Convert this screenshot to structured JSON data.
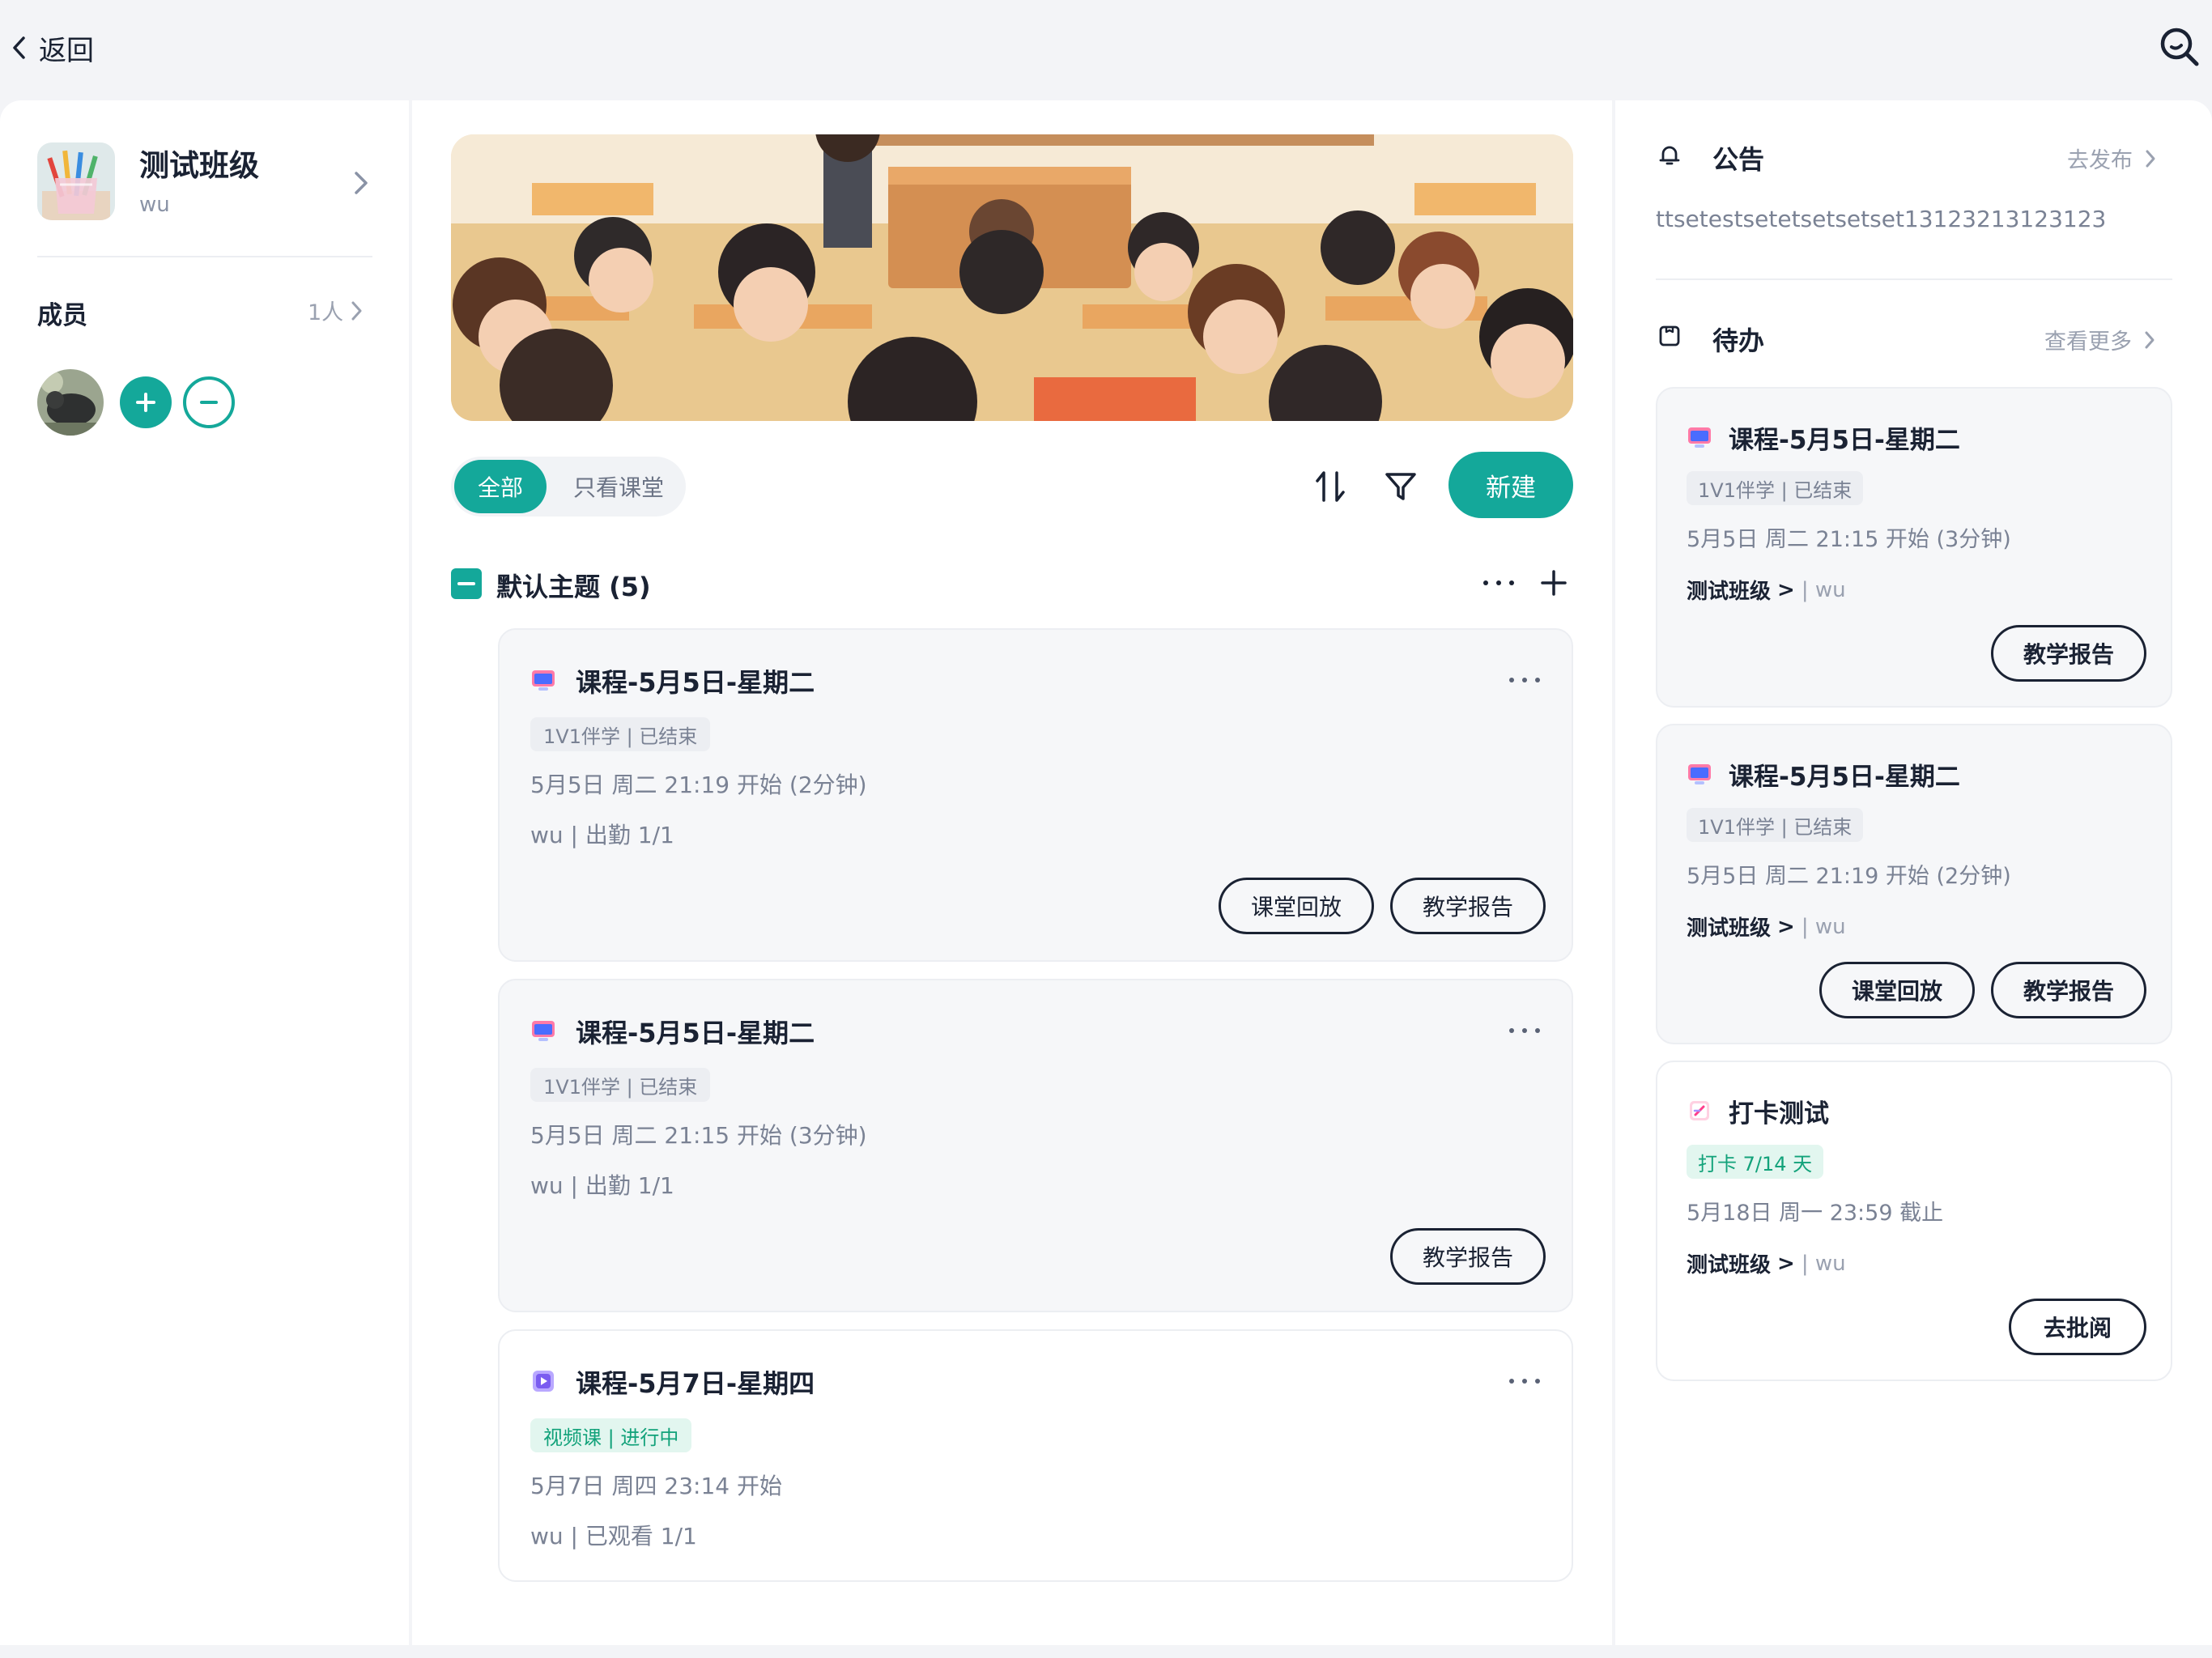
{
  "topbar": {
    "back_label": "返回"
  },
  "class_info": {
    "name": "测试班级",
    "owner": "wu",
    "members_title": "成员",
    "members_count": "1人"
  },
  "filters": {
    "all": "全部",
    "class_only": "只看课堂"
  },
  "actions": {
    "new": "新建"
  },
  "topic": {
    "title": "默认主题 (5)"
  },
  "lessons": [
    {
      "title": "课程-5月5日-星期二",
      "tag": "1V1伴学 | 已结束",
      "time": "5月5日 周二 21:19 开始 (2分钟)",
      "attendance": "wu | 出勤 1/1",
      "buttons": [
        "课堂回放",
        "教学报告"
      ]
    },
    {
      "title": "课程-5月5日-星期二",
      "tag": "1V1伴学 | 已结束",
      "time": "5月5日 周二 21:15 开始 (3分钟)",
      "attendance": "wu | 出勤 1/1",
      "buttons": [
        "教学报告"
      ]
    },
    {
      "title": "课程-5月7日-星期四",
      "tag": "视频课 | 进行中",
      "time": "5月7日 周四 23:14 开始",
      "attendance": "wu | 已观看 1/1",
      "buttons": []
    }
  ],
  "notice": {
    "title": "公告",
    "action": "去发布",
    "text": "ttsetestsetetsetsetset13123213123123"
  },
  "todo": {
    "title": "待办",
    "action": "查看更多",
    "items": [
      {
        "title": "课程-5月5日-星期二",
        "tag": "1V1伴学 | 已结束",
        "time": "5月5日 周二 21:15 开始 (3分钟)",
        "class_name": "测试班级",
        "separator": ">",
        "user": "| wu",
        "buttons": [
          "教学报告"
        ]
      },
      {
        "title": "课程-5月5日-星期二",
        "tag": "1V1伴学 | 已结束",
        "time": "5月5日 周二 21:19 开始 (2分钟)",
        "class_name": "测试班级",
        "separator": ">",
        "user": "| wu",
        "buttons": [
          "课堂回放",
          "教学报告"
        ]
      },
      {
        "title": "打卡测试",
        "tag": "打卡 7/14 天",
        "time": "5月18日 周一 23:59 截止",
        "class_name": "测试班级",
        "separator": ">",
        "user": "| wu",
        "buttons": [
          "去批阅"
        ]
      }
    ]
  },
  "colors": {
    "accent": "#14a89a",
    "background": "#f3f4f7",
    "card": "#f6f7f9",
    "text": "#1a2233",
    "muted": "#7a8294",
    "tag_green_bg": "#e2f6ef",
    "tag_green_text": "#12a27a"
  },
  "icons": {
    "back": "chevron-left-icon",
    "search": "search-icon",
    "sort": "sort-icon",
    "filter": "filter-icon",
    "notice": "bell-icon",
    "todo": "todo-icon",
    "lesson": "screen-icon",
    "video": "video-icon",
    "checkin": "checkin-icon"
  }
}
